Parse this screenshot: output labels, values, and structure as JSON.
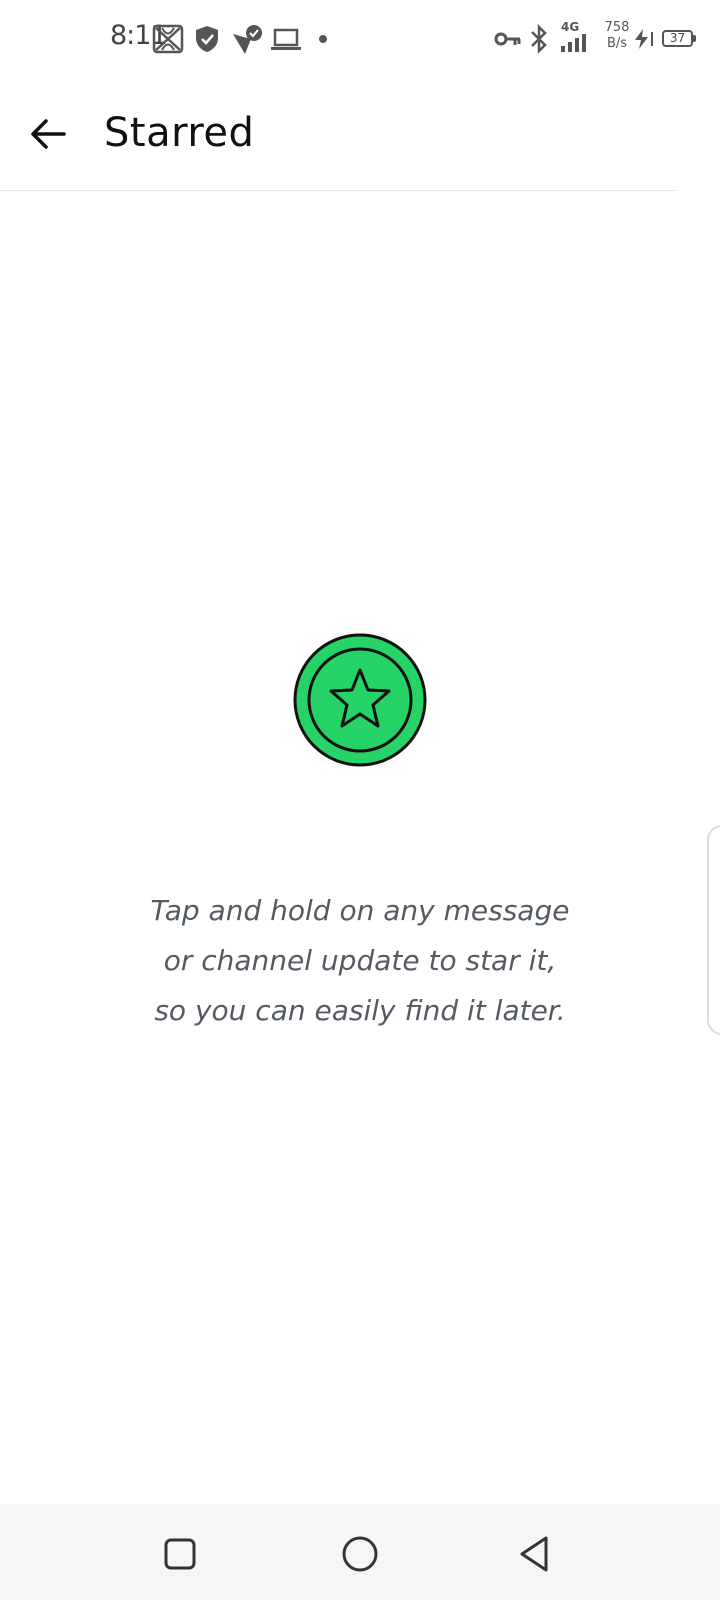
{
  "status_bar": {
    "time": "8:11",
    "network_speed_value": "758",
    "network_speed_unit": "B/s",
    "network_type": "4G",
    "battery_level": "37",
    "icons": [
      "remote-icon",
      "shield-icon",
      "vpn-check-icon",
      "laptop-icon",
      "dot-icon",
      "key-icon",
      "bluetooth-icon",
      "signal-icon",
      "charging-icon",
      "battery-icon"
    ]
  },
  "toolbar": {
    "back_icon": "arrow-left-icon",
    "title": "Starred"
  },
  "empty_state": {
    "icon": "star-badge-icon",
    "accent_color": "#25D366",
    "message": "Tap and hold on any message or channel update to star it, so you can easily find it later."
  },
  "navigation_bar": {
    "buttons": [
      "recents-button",
      "home-button",
      "back-button"
    ]
  }
}
